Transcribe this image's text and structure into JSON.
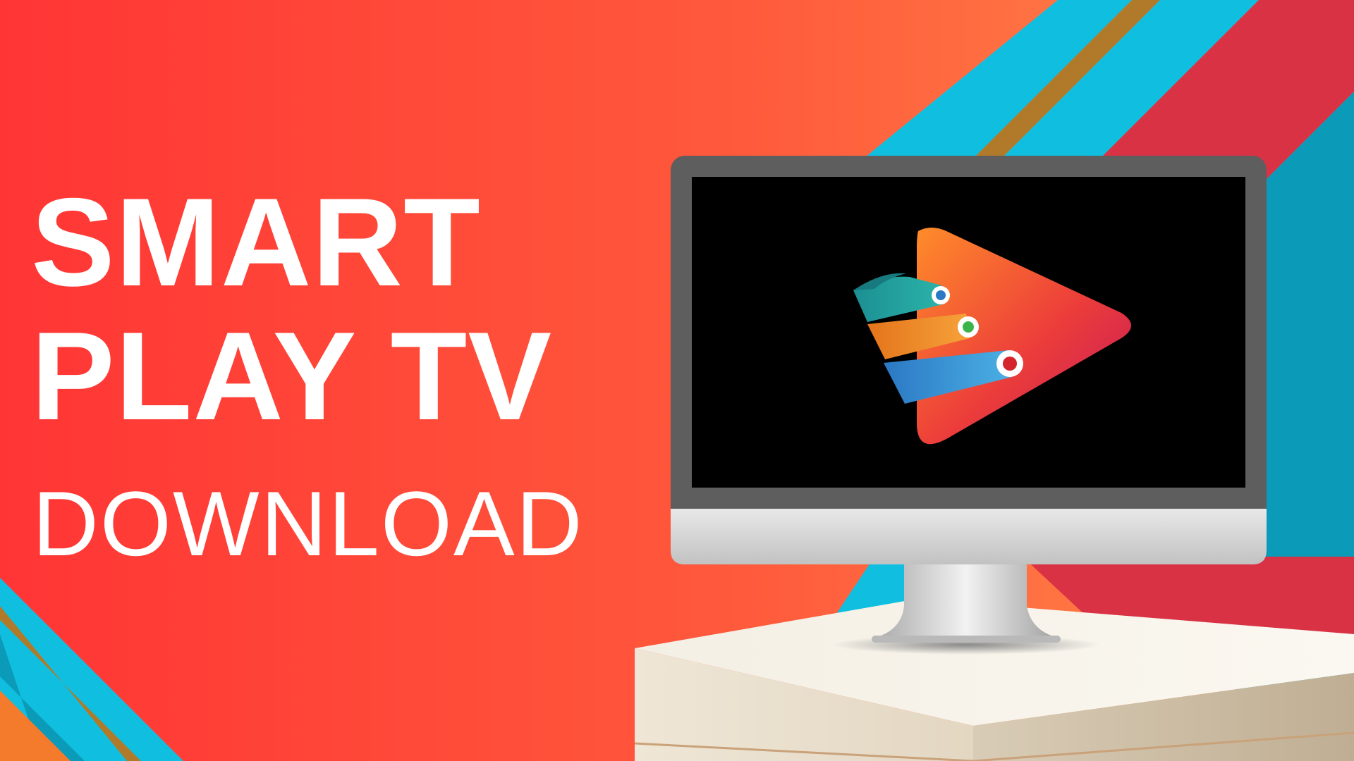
{
  "headline": {
    "line1": "SMART",
    "line2": "PLAY TV",
    "subline": "DOWNLOAD"
  },
  "colors": {
    "background_left": "#ff3535",
    "background_right": "#ff7a45",
    "stripe_cyan": "#10bfe0",
    "stripe_gold": "#b07a2a",
    "stripe_crimson": "#d93245",
    "stripe_teal": "#0b9ab8",
    "monitor_bezel": "#5e5e5e",
    "monitor_chin": "#d4d4d4",
    "screen": "#000000",
    "pedestal": "#efe7d8",
    "text": "#ffffff"
  },
  "illustration": {
    "device": "monitor-icon",
    "logo": "play-logo-icon"
  }
}
